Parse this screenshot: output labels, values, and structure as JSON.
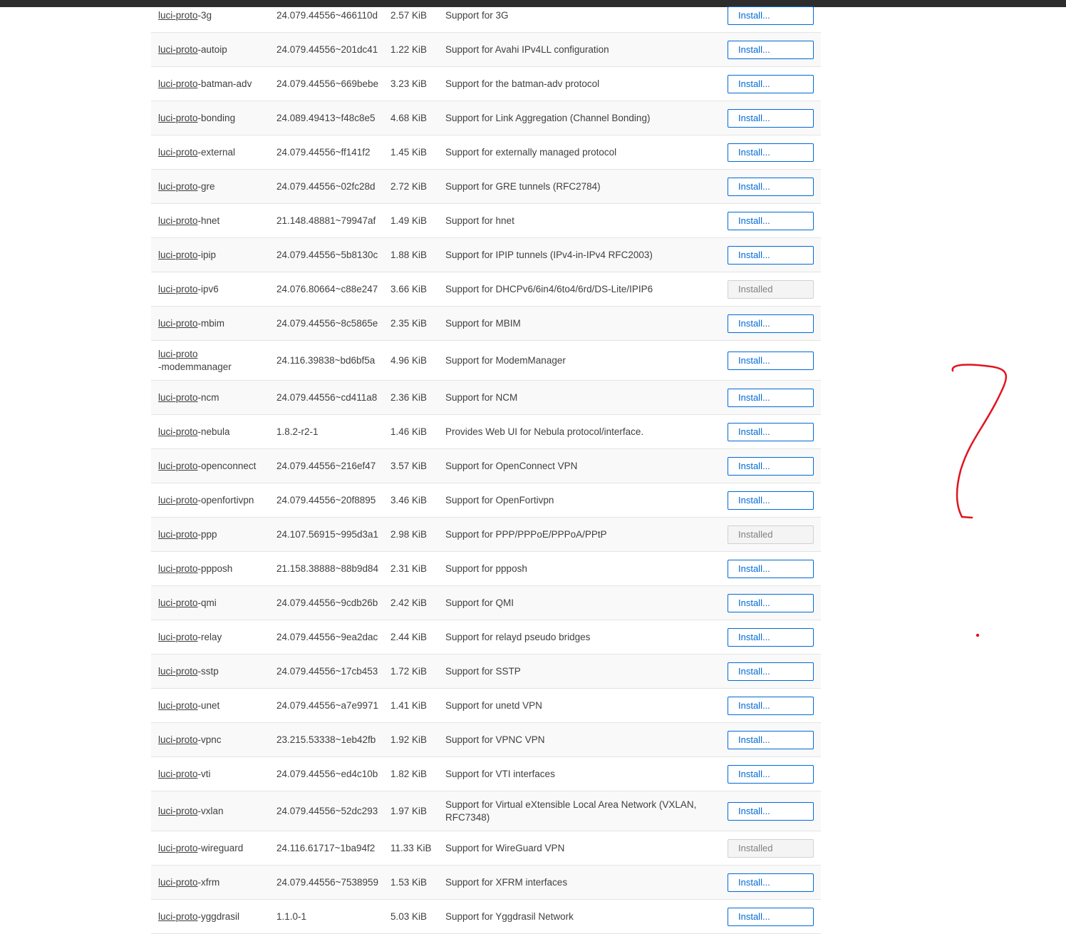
{
  "package_prefix": "luci-proto",
  "packages": [
    {
      "suffix": "-3g",
      "version": "24.079.44556~466110d",
      "size": "2.57 KiB",
      "description": "Support for 3G",
      "action": "Install..."
    },
    {
      "suffix": "-autoip",
      "version": "24.079.44556~201dc41",
      "size": "1.22 KiB",
      "description": "Support for Avahi IPv4LL configuration",
      "action": "Install..."
    },
    {
      "suffix": "-batman-adv",
      "version": "24.079.44556~669bebe",
      "size": "3.23 KiB",
      "description": "Support for the batman-adv protocol",
      "action": "Install..."
    },
    {
      "suffix": "-bonding",
      "version": "24.089.49413~f48c8e5",
      "size": "4.68 KiB",
      "description": "Support for Link Aggregation (Channel Bonding)",
      "action": "Install..."
    },
    {
      "suffix": "-external",
      "version": "24.079.44556~ff141f2",
      "size": "1.45 KiB",
      "description": "Support for externally managed protocol",
      "action": "Install..."
    },
    {
      "suffix": "-gre",
      "version": "24.079.44556~02fc28d",
      "size": "2.72 KiB",
      "description": "Support for GRE tunnels (RFC2784)",
      "action": "Install..."
    },
    {
      "suffix": "-hnet",
      "version": "21.148.48881~79947af",
      "size": "1.49 KiB",
      "description": "Support for hnet",
      "action": "Install..."
    },
    {
      "suffix": "-ipip",
      "version": "24.079.44556~5b8130c",
      "size": "1.88 KiB",
      "description": "Support for IPIP tunnels (IPv4-in-IPv4 RFC2003)",
      "action": "Install..."
    },
    {
      "suffix": "-ipv6",
      "version": "24.076.80664~c88e247",
      "size": "3.66 KiB",
      "description": "Support for DHCPv6/6in4/6to4/6rd/DS-Lite/IPIP6",
      "action": "Installed"
    },
    {
      "suffix": "-mbim",
      "version": "24.079.44556~8c5865e",
      "size": "2.35 KiB",
      "description": "Support for MBIM",
      "action": "Install..."
    },
    {
      "suffix": "-modemmanager",
      "version": "24.116.39838~bd6bf5a",
      "size": "4.96 KiB",
      "description": "Support for ModemManager",
      "action": "Install..."
    },
    {
      "suffix": "-ncm",
      "version": "24.079.44556~cd411a8",
      "size": "2.36 KiB",
      "description": "Support for NCM",
      "action": "Install..."
    },
    {
      "suffix": "-nebula",
      "version": "1.8.2-r2-1",
      "size": "1.46 KiB",
      "description": "Provides Web UI for Nebula protocol/interface.",
      "action": "Install..."
    },
    {
      "suffix": "-openconnect",
      "version": "24.079.44556~216ef47",
      "size": "3.57 KiB",
      "description": "Support for OpenConnect VPN",
      "action": "Install..."
    },
    {
      "suffix": "-openfortivpn",
      "version": "24.079.44556~20f8895",
      "size": "3.46 KiB",
      "description": "Support for OpenFortivpn",
      "action": "Install..."
    },
    {
      "suffix": "-ppp",
      "version": "24.107.56915~995d3a1",
      "size": "2.98 KiB",
      "description": "Support for PPP/PPPoE/PPPoA/PPtP",
      "action": "Installed"
    },
    {
      "suffix": "-ppposh",
      "version": "21.158.38888~88b9d84",
      "size": "2.31 KiB",
      "description": "Support for ppposh",
      "action": "Install..."
    },
    {
      "suffix": "-qmi",
      "version": "24.079.44556~9cdb26b",
      "size": "2.42 KiB",
      "description": "Support for QMI",
      "action": "Install..."
    },
    {
      "suffix": "-relay",
      "version": "24.079.44556~9ea2dac",
      "size": "2.44 KiB",
      "description": "Support for relayd pseudo bridges",
      "action": "Install..."
    },
    {
      "suffix": "-sstp",
      "version": "24.079.44556~17cb453",
      "size": "1.72 KiB",
      "description": "Support for SSTP",
      "action": "Install..."
    },
    {
      "suffix": "-unet",
      "version": "24.079.44556~a7e9971",
      "size": "1.41 KiB",
      "description": "Support for unetd VPN",
      "action": "Install..."
    },
    {
      "suffix": "-vpnc",
      "version": "23.215.53338~1eb42fb",
      "size": "1.92 KiB",
      "description": "Support for VPNC VPN",
      "action": "Install..."
    },
    {
      "suffix": "-vti",
      "version": "24.079.44556~ed4c10b",
      "size": "1.82 KiB",
      "description": "Support for VTI interfaces",
      "action": "Install..."
    },
    {
      "suffix": "-vxlan",
      "version": "24.079.44556~52dc293",
      "size": "1.97 KiB",
      "description": "Support for Virtual eXtensible Local Area Network (VXLAN, RFC7348)",
      "action": "Install..."
    },
    {
      "suffix": "-wireguard",
      "version": "24.116.61717~1ba94f2",
      "size": "11.33 KiB",
      "description": "Support for WireGuard VPN",
      "action": "Installed"
    },
    {
      "suffix": "-xfrm",
      "version": "24.079.44556~7538959",
      "size": "1.53 KiB",
      "description": "Support for XFRM interfaces",
      "action": "Install..."
    },
    {
      "suffix": "-yggdrasil",
      "version": "1.1.0-1",
      "size": "5.03 KiB",
      "description": "Support for Yggdrasil Network",
      "action": "Install..."
    }
  ],
  "colors": {
    "install_button": "#0069d6",
    "installed_button": "#808080",
    "annotation_red": "#e0141e",
    "topbar": "#2d2d2d"
  }
}
